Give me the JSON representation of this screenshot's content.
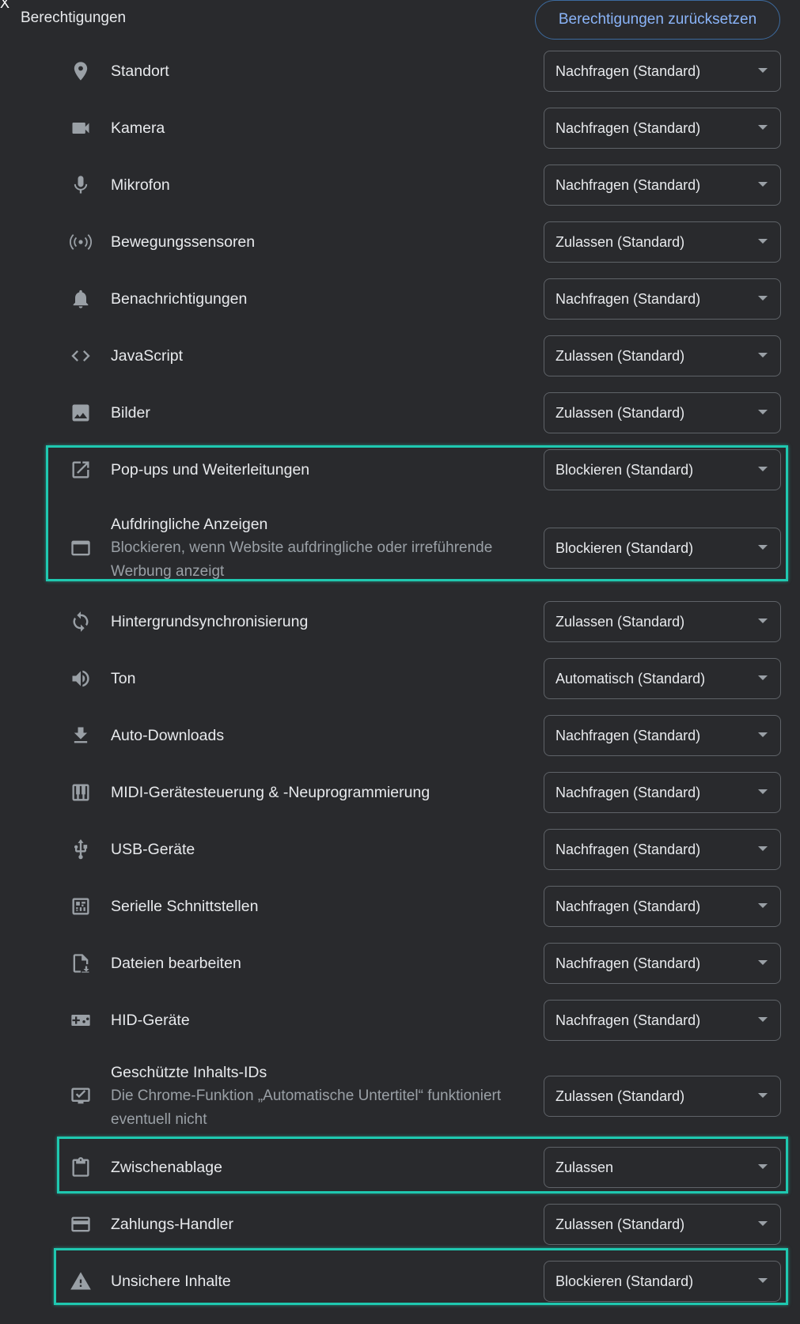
{
  "header": {
    "title": "Berechtigungen",
    "reset_label": "Berechtigungen zurücksetzen",
    "corner_mark": "X"
  },
  "permissions": [
    {
      "icon": "location-pin-icon",
      "label": "Standort",
      "sublabel": "",
      "value": "Nachfragen (Standard)"
    },
    {
      "icon": "camera-icon",
      "label": "Kamera",
      "sublabel": "",
      "value": "Nachfragen (Standard)"
    },
    {
      "icon": "microphone-icon",
      "label": "Mikrofon",
      "sublabel": "",
      "value": "Nachfragen (Standard)"
    },
    {
      "icon": "sensors-icon",
      "label": "Bewegungssensoren",
      "sublabel": "",
      "value": "Zulassen (Standard)"
    },
    {
      "icon": "bell-icon",
      "label": "Benachrichtigungen",
      "sublabel": "",
      "value": "Nachfragen (Standard)"
    },
    {
      "icon": "code-icon",
      "label": "JavaScript",
      "sublabel": "",
      "value": "Zulassen (Standard)"
    },
    {
      "icon": "image-icon",
      "label": "Bilder",
      "sublabel": "",
      "value": "Zulassen (Standard)"
    },
    {
      "icon": "open-in-new-icon",
      "label": "Pop-ups und Weiterleitungen",
      "sublabel": "",
      "value": "Blockieren (Standard)"
    },
    {
      "icon": "window-icon",
      "label": "Aufdringliche Anzeigen",
      "sublabel": "Blockieren, wenn Website aufdringliche oder irreführende Werbung anzeigt",
      "value": "Blockieren (Standard)"
    },
    {
      "icon": "sync-icon",
      "label": "Hintergrundsynchronisierung",
      "sublabel": "",
      "value": "Zulassen (Standard)"
    },
    {
      "icon": "volume-icon",
      "label": "Ton",
      "sublabel": "",
      "value": "Automatisch (Standard)"
    },
    {
      "icon": "download-icon",
      "label": "Auto-Downloads",
      "sublabel": "",
      "value": "Nachfragen (Standard)"
    },
    {
      "icon": "piano-icon",
      "label": "MIDI-Gerätesteuerung & -Neuprogrammierung",
      "sublabel": "",
      "value": "Nachfragen (Standard)"
    },
    {
      "icon": "usb-icon",
      "label": "USB-Geräte",
      "sublabel": "",
      "value": "Nachfragen (Standard)"
    },
    {
      "icon": "serial-port-icon",
      "label": "Serielle Schnittstellen",
      "sublabel": "",
      "value": "Nachfragen (Standard)"
    },
    {
      "icon": "file-edit-icon",
      "label": "Dateien bearbeiten",
      "sublabel": "",
      "value": "Nachfragen (Standard)"
    },
    {
      "icon": "gamepad-icon",
      "label": "HID-Geräte",
      "sublabel": "",
      "value": "Nachfragen (Standard)"
    },
    {
      "icon": "protected-content-icon",
      "label": "Geschützte Inhalts-IDs",
      "sublabel": "Die Chrome-Funktion „Automatische Untertitel“ funktioniert eventuell nicht",
      "value": "Zulassen (Standard)"
    },
    {
      "icon": "clipboard-icon",
      "label": "Zwischenablage",
      "sublabel": "",
      "value": "Zulassen"
    },
    {
      "icon": "credit-card-icon",
      "label": "Zahlungs-Handler",
      "sublabel": "",
      "value": "Zulassen (Standard)"
    },
    {
      "icon": "warning-icon",
      "label": "Unsichere Inhalte",
      "sublabel": "",
      "value": "Blockieren (Standard)"
    }
  ],
  "colors": {
    "highlight": "#1fc8b0",
    "background": "#292a2d",
    "accent": "#8ab4f8"
  }
}
